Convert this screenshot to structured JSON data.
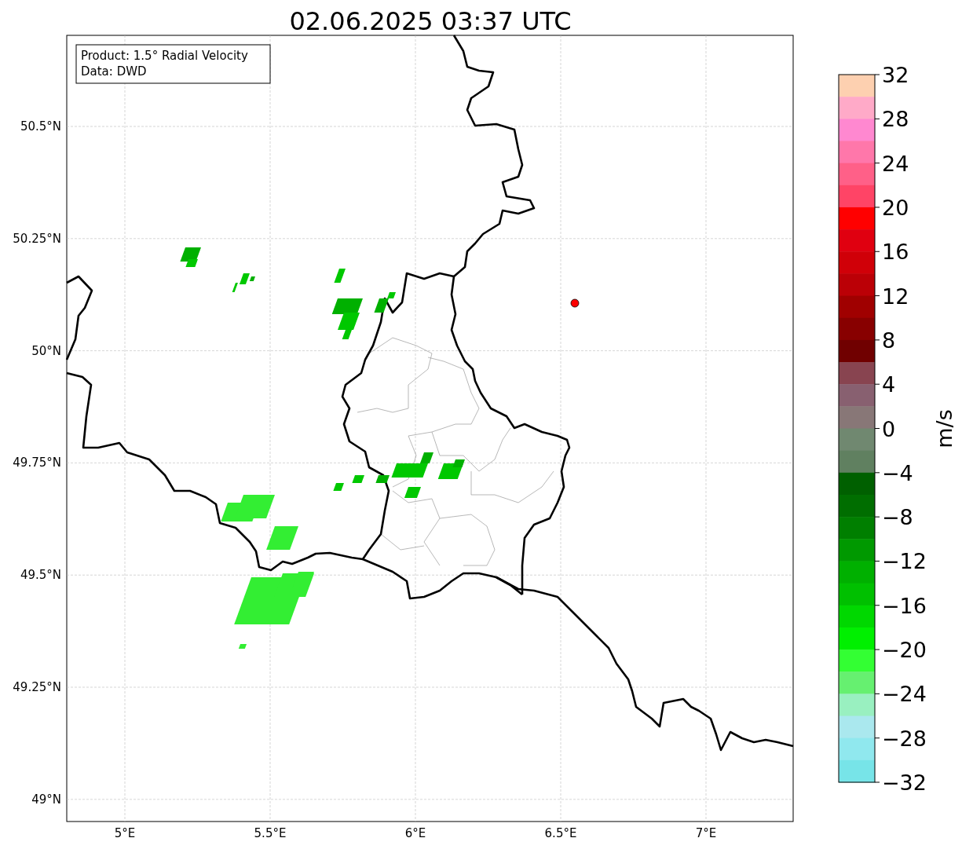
{
  "title": "02.06.2025 03:37 UTC",
  "info_box": [
    "Product: 1.5° Radial Velocity",
    "Data: DWD"
  ],
  "map": {
    "lat_labels": [
      "50.5°N",
      "50.25°N",
      "50°N",
      "49.75°N",
      "49.5°N",
      "49.25°N",
      "49°N"
    ],
    "lon_labels": [
      "5°E",
      "5.5°E",
      "6°E",
      "6.5°E",
      "7°E"
    ]
  },
  "colorbar": {
    "label": "m/s",
    "ticks": [
      "32",
      "28",
      "24",
      "20",
      "16",
      "12",
      "8",
      "4",
      "0",
      "−4",
      "−8",
      "−12",
      "−16",
      "−20",
      "−24",
      "−28",
      "−32"
    ],
    "bands": [
      {
        "color": "#fdd0b0"
      },
      {
        "color": "#ffaac8"
      },
      {
        "color": "#ff88d0"
      },
      {
        "color": "#ff77aa"
      },
      {
        "color": "#ff6088"
      },
      {
        "color": "#ff4466"
      },
      {
        "color": "#ff0000"
      },
      {
        "color": "#e00010"
      },
      {
        "color": "#d00008"
      },
      {
        "color": "#bb0006"
      },
      {
        "color": "#a00000"
      },
      {
        "color": "#880000"
      },
      {
        "color": "#700000"
      },
      {
        "color": "#884450"
      },
      {
        "color": "#886070"
      },
      {
        "color": "#887777"
      },
      {
        "color": "#708870"
      },
      {
        "color": "#608060"
      },
      {
        "color": "#006000"
      },
      {
        "color": "#006e00"
      },
      {
        "color": "#007f00"
      },
      {
        "color": "#009900"
      },
      {
        "color": "#00b000"
      },
      {
        "color": "#00c000"
      },
      {
        "color": "#00d800"
      },
      {
        "color": "#00f000"
      },
      {
        "color": "#33ff33"
      },
      {
        "color": "#66f070"
      },
      {
        "color": "#99f0c0"
      },
      {
        "color": "#aae8ee"
      },
      {
        "color": "#90e8ee"
      },
      {
        "color": "#77e4e8"
      }
    ]
  }
}
